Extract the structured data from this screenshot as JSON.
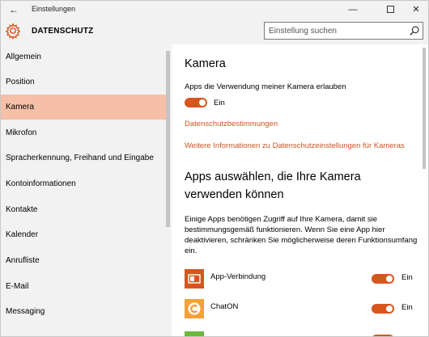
{
  "window": {
    "title": "Einstellungen",
    "back_glyph": "←",
    "minimize_glyph": "—",
    "close_glyph": "✕"
  },
  "header": {
    "title": "DATENSCHUTZ",
    "search_placeholder": "Einstellung suchen",
    "accent": "#d6561e"
  },
  "sidebar": {
    "items": [
      {
        "label": "Allgemein"
      },
      {
        "label": "Position"
      },
      {
        "label": "Kamera"
      },
      {
        "label": "Mikrofon"
      },
      {
        "label": "Spracherkennung, Freihand und Eingabe"
      },
      {
        "label": "Kontoinformationen"
      },
      {
        "label": "Kontakte"
      },
      {
        "label": "Kalender"
      },
      {
        "label": "Anrufliste"
      },
      {
        "label": "E-Mail"
      },
      {
        "label": "Messaging"
      }
    ],
    "active_index": 2,
    "active_color": "#f5bfa8"
  },
  "main": {
    "section_title": "Kamera",
    "allow_label": "Apps die Verwendung meiner Kamera erlauben",
    "allow_toggle": {
      "state": "on",
      "label": "Ein"
    },
    "privacy_link": "Datenschutzbestimmungen",
    "more_info_link": "Weitere Informationen zu Datenschutzeinstellungen für Kameras",
    "apps_title_line1": "Apps auswählen, die Ihre Kamera",
    "apps_title_line2": "verwenden können",
    "apps_description": "Einige Apps benötigen Zugriff auf Ihre Kamera, damit sie bestimmungsgemäß funktionieren. Wenn Sie eine App hier deaktivieren, schränken Sie möglicherweise deren Funktionsumfang ein.",
    "apps": [
      {
        "name": "App-Verbindung",
        "toggle_label": "Ein",
        "state": "on",
        "icon": "app-connector-icon",
        "icon_color": "#d6561e"
      },
      {
        "name": "ChatON",
        "toggle_label": "Ein",
        "state": "on",
        "icon": "chaton-icon",
        "icon_color": "#f4a13a"
      }
    ],
    "link_color": "#d0531f"
  }
}
